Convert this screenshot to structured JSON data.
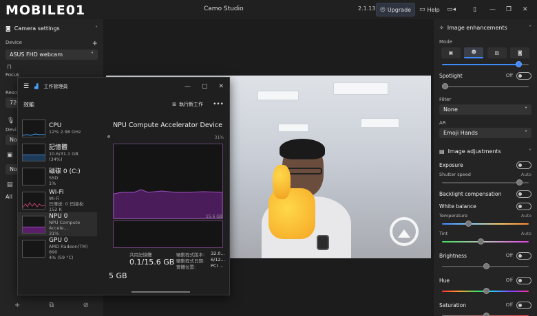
{
  "brand": {
    "logo_text": "MOBILE01"
  },
  "titlebar": {
    "title": "Camo Studio",
    "version": "2.1.13",
    "upgrade": "Upgrade",
    "help": "Help"
  },
  "left": {
    "camera_settings": "Camera settings",
    "device_label": "Device",
    "device_value": "ASUS FHD webcam",
    "focus_label": "Focus",
    "resolution_label": "Resol",
    "resolution_value": "720",
    "audio_device_label": "Devi",
    "audio_value": "No",
    "overlay_value": "No",
    "all_label": "All"
  },
  "taskmgr": {
    "app_title": "工作管理員",
    "section": "效能",
    "run_task": "執行新工作",
    "items": [
      {
        "name": "CPU",
        "line2": "12% 2.98 GHz",
        "line3": ""
      },
      {
        "name": "記憶體",
        "line2": "10.6/31.1 GB (34%)",
        "line3": ""
      },
      {
        "name": "磁碟 0 (C:)",
        "line2": "SSD",
        "line3": "1%"
      },
      {
        "name": "Wi-Fi",
        "line2": "Wi-Fi",
        "line3": "已傳送: 0 已接收: 152 K"
      },
      {
        "name": "NPU 0",
        "line2": "NPU Compute Accele...",
        "line3": "31%"
      },
      {
        "name": "GPU 0",
        "line2": "AMD Radeon(TM) 890",
        "line3": "4% (59 °C)"
      }
    ],
    "main_title": "NPU Compute Accelerator Device",
    "graph_top_right": "31%",
    "graph_left_char": "e",
    "graph2_right": "15.6 GB",
    "shared_mem_label": "共用記憶體",
    "shared_mem_value": "0.1/15.6 GB",
    "left_value": "5 GB",
    "driver_version_label": "驅動程式版本:",
    "driver_version_value": "32.0...",
    "driver_date_label": "驅動程式日期:",
    "driver_date_value": "6/12...",
    "physical_location_label": "實體位置:",
    "physical_location_value": "PCI ..."
  },
  "right": {
    "image_enhancements": "Image enhancements",
    "mode_label": "Mode",
    "mode_value": 0.88,
    "spotlight_label": "Spotlight",
    "spotlight_state": "Off",
    "filter_label": "Filter",
    "filter_value": "None",
    "ar_label": "AR",
    "ar_value": "Emoji Hands",
    "image_adjustments": "Image adjustments",
    "exposure": "Exposure",
    "shutter_speed": "Shutter speed",
    "shutter_state": "Auto",
    "backlight": "Backlight compensation",
    "white_balance": "White balance",
    "temperature": "Temperature",
    "temperature_state": "Auto",
    "tint": "Tint",
    "tint_state": "Auto",
    "brightness": "Brightness",
    "brightness_state": "Off",
    "hue": "Hue",
    "hue_state": "Off",
    "saturation": "Saturation",
    "saturation_state": "Off"
  }
}
